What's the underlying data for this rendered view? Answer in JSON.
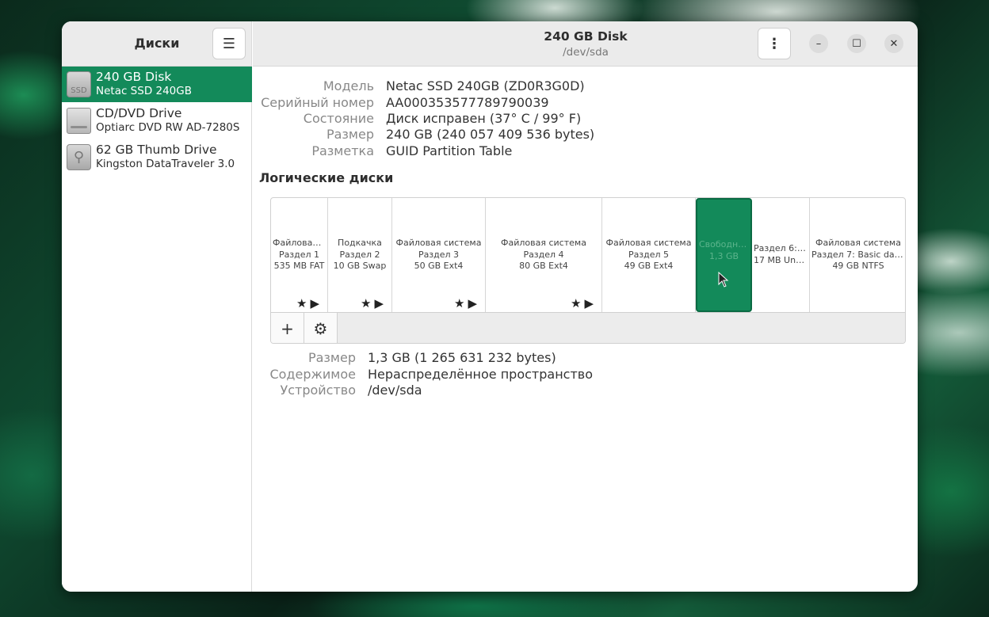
{
  "sidebar": {
    "title": "Диски",
    "drives": [
      {
        "name": "240 GB Disk",
        "model": "Netac SSD 240GB",
        "icon_label": "SSD",
        "icon": "ssd-icon",
        "selected": true
      },
      {
        "name": "CD/DVD Drive",
        "model": "Optiarc DVD RW AD-7280S",
        "icon": "optical-drive-icon",
        "selected": false
      },
      {
        "name": "62 GB Thumb Drive",
        "model": "Kingston DataTraveler 3.0",
        "icon": "usb-drive-icon",
        "selected": false
      }
    ]
  },
  "header": {
    "title": "240 GB Disk",
    "subtitle": "/dev/sda",
    "menu_glyph": "⋮",
    "controls": {
      "minimize": "–",
      "maximize": "☐",
      "close": "✕"
    }
  },
  "disk_info": {
    "labels": [
      "Модель",
      "Серийный номер",
      "Состояние",
      "Размер",
      "Разметка"
    ],
    "values": [
      "Netac SSD 240GB (ZD0R3G0D)",
      "AA000353577789790039",
      "Диск исправен (37° C / 99° F)",
      "240 GB (240 057 409 536 bytes)",
      "GUID Partition Table"
    ]
  },
  "volumes": {
    "title": "Логические диски",
    "segments": [
      {
        "lines": [
          "Файловая...",
          "Раздел 1",
          "535 MB FAT"
        ],
        "actions": "★▶",
        "free": false
      },
      {
        "lines": [
          "Подкачка",
          "Раздел 2",
          "10 GB Swap"
        ],
        "actions": "★▶",
        "free": false
      },
      {
        "lines": [
          "Файловая система",
          "Раздел 3",
          "50 GB Ext4"
        ],
        "actions": "★▶",
        "free": false
      },
      {
        "lines": [
          "Файловая система",
          "Раздел 4",
          "80 GB Ext4"
        ],
        "actions": "★▶",
        "free": false
      },
      {
        "lines": [
          "Файловая система",
          "Раздел 5",
          "49 GB Ext4"
        ],
        "actions": "",
        "free": false
      },
      {
        "lines": [
          "Свободно...",
          "1,3 GB"
        ],
        "actions": "",
        "free": true
      },
      {
        "lines": [
          "Раздел 6: ...",
          "17 MB Unk..."
        ],
        "actions": "",
        "free": false
      },
      {
        "lines": [
          "Файловая система",
          "Раздел 7: Basic dat...",
          "49 GB NTFS"
        ],
        "actions": "",
        "free": false
      }
    ],
    "toolbar": {
      "add": "+",
      "settings": "⚙"
    }
  },
  "selection_info": {
    "labels": [
      "Размер",
      "Содержимое",
      "Устройство"
    ],
    "values": [
      "1,3 GB (1 265 631 232 bytes)",
      "Нераспределённое пространство",
      "/dev/sda"
    ]
  },
  "colors": {
    "accent": "#138a5a"
  }
}
